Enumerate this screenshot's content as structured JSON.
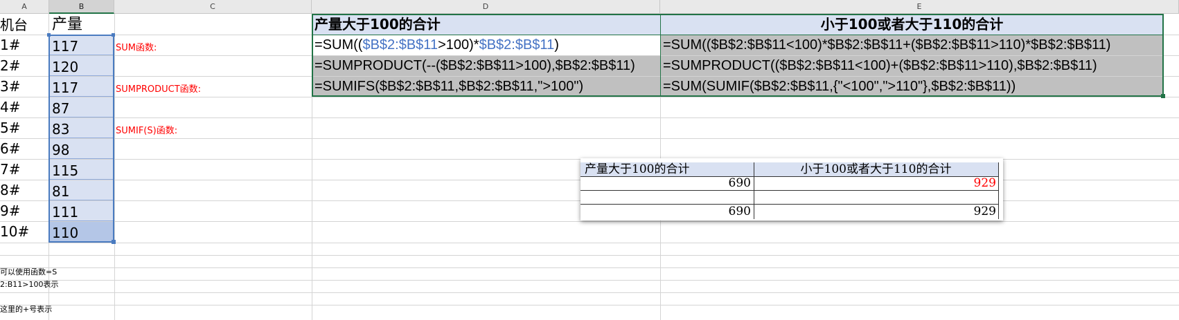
{
  "columns": [
    "A",
    "B",
    "C",
    "D",
    "E"
  ],
  "col_a": {
    "header": "机台",
    "values": [
      "1#",
      "2#",
      "3#",
      "4#",
      "5#",
      "6#",
      "7#",
      "8#",
      "9#",
      "10#"
    ]
  },
  "col_b": {
    "header": "产量",
    "values": [
      "117",
      "120",
      "117",
      "87",
      "83",
      "98",
      "115",
      "81",
      "111",
      "110"
    ]
  },
  "labels": {
    "sum": "SUM函数:",
    "sumproduct": "SUMPRODUCT函数:",
    "sumifs": "SUMIF(S)函数:"
  },
  "notes": [
    "可以使用函数=S",
    "2:B11>100表示",
    "这里的+号表示"
  ],
  "table": {
    "header_d": "产量大于100的合计",
    "header_e": "小于100或者大于110的合计",
    "formula_d1_parts": [
      "=SUM((",
      "$B$2:$B$11",
      ">100)*",
      "$B$2:$B$11",
      ")"
    ],
    "formula_d2": "=SUMPRODUCT(--($B$2:$B$11>100),$B$2:$B$11)",
    "formula_d3": "=SUMIFS($B$2:$B$11,$B$2:$B$11,\">100\")",
    "formula_e1": "=SUM(($B$2:$B$11<100)*$B$2:$B$11+($B$2:$B$11>110)*$B$2:$B$11)",
    "formula_e2": "=SUMPRODUCT(($B$2:$B$11<100)+($B$2:$B$11>110),$B$2:$B$11)",
    "formula_e3": "=SUM(SUMIF($B$2:$B$11,{\"<100\",\">110\"},$B$2:$B$11))"
  },
  "popup": {
    "header_1": "产量大于100的合计",
    "header_2": "小于100或者大于110的合计",
    "row1": [
      "690",
      "929"
    ],
    "row2": [
      "",
      ""
    ],
    "row3": [
      "690",
      "929"
    ]
  },
  "colors": {
    "header_fill": "#d9e1f2",
    "gray_fill": "#c0c0c0",
    "ref_blue": "#4472c4",
    "accent_red": "#ff0000",
    "selection_green": "#217346"
  }
}
